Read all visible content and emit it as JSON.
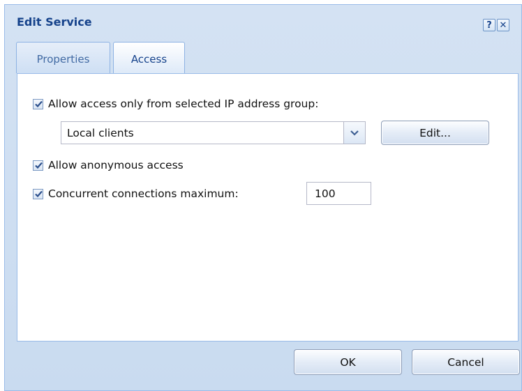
{
  "dialog": {
    "title": "Edit Service",
    "help_glyph": "?",
    "close_glyph": "✕"
  },
  "tabs": [
    {
      "label": "Properties",
      "active": false
    },
    {
      "label": "Access",
      "active": true
    }
  ],
  "access": {
    "ip_group_restrict": {
      "checked": true,
      "label": "Allow access only from selected IP address group:"
    },
    "ip_group_select": {
      "value": "Local clients"
    },
    "edit_button_label": "Edit...",
    "anonymous": {
      "checked": true,
      "label": "Allow anonymous access"
    },
    "concurrent": {
      "checked": true,
      "label": "Concurrent connections maximum:",
      "value": "100"
    }
  },
  "footer": {
    "ok_label": "OK",
    "cancel_label": "Cancel"
  },
  "icons": {
    "checkmark": "check-icon",
    "dropdown": "chevron-down-icon",
    "help": "help-icon",
    "close": "close-icon"
  },
  "colors": {
    "title_text": "#15428b",
    "frame_bg": "#cfdff2",
    "border": "#99bbe8",
    "checkmark": "#2b4f8c"
  }
}
